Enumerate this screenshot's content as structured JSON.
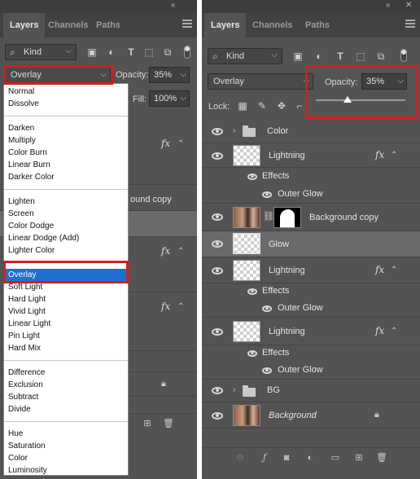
{
  "left_panel": {
    "tabs": [
      "Layers",
      "Channels",
      "Paths"
    ],
    "filter_kind": "Kind",
    "blend_mode": "Overlay",
    "opacity_label": "Opacity:",
    "opacity_value": "35%",
    "fill_label": "Fill:",
    "fill_value": "100%",
    "peek_text": "ound copy",
    "blend_groups": [
      [
        "Normal",
        "Dissolve"
      ],
      [
        "Darken",
        "Multiply",
        "Color Burn",
        "Linear Burn",
        "Darker Color"
      ],
      [
        "Lighten",
        "Screen",
        "Color Dodge",
        "Linear Dodge (Add)",
        "Lighter Color"
      ],
      [
        "Overlay",
        "Soft Light",
        "Hard Light",
        "Vivid Light",
        "Linear Light",
        "Pin Light",
        "Hard Mix"
      ],
      [
        "Difference",
        "Exclusion",
        "Subtract",
        "Divide"
      ],
      [
        "Hue",
        "Saturation",
        "Color",
        "Luminosity"
      ]
    ],
    "selected_blend": "Overlay"
  },
  "right_panel": {
    "tabs": [
      "Layers",
      "Channels",
      "Paths"
    ],
    "filter_kind": "Kind",
    "blend_mode": "Overlay",
    "opacity_label": "Opacity:",
    "opacity_value": "35%",
    "opacity_fraction": 0.35,
    "lock_label": "Lock:",
    "layers": {
      "color_group": "Color",
      "lightning_1": "Lightning",
      "effects_1": "Effects",
      "outer_glow_1": "Outer Glow",
      "background_copy": "Background copy",
      "glow": "Glow",
      "lightning_2": "Lightning",
      "effects_2": "Effects",
      "outer_glow_2": "Outer Glow",
      "lightning_3": "Lightning",
      "effects_3": "Effects",
      "outer_glow_3": "Outer Glow",
      "bg_group": "BG",
      "background": "Background"
    },
    "fx_symbol": "fx"
  },
  "colors": {
    "panel_bg": "#535353",
    "highlight_red": "#d21f1f",
    "selection_blue": "#1e6fd0"
  },
  "icons": [
    "search-icon",
    "image-filter-icon",
    "adjustment-filter-icon",
    "type-filter-icon",
    "shape-filter-icon",
    "smart-object-filter-icon",
    "eye-icon",
    "folder-icon",
    "lock-icon",
    "link-icon",
    "trash-icon",
    "new-layer-icon",
    "mask-icon",
    "fx-icon"
  ]
}
